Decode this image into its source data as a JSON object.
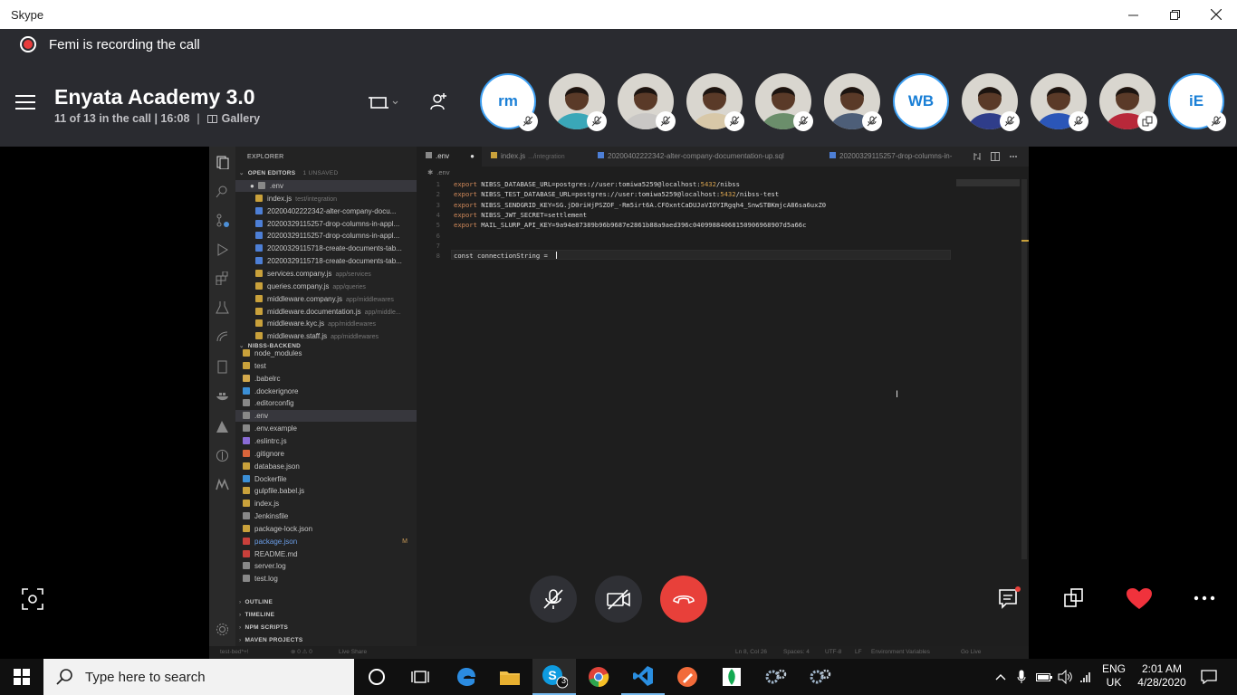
{
  "window": {
    "app_name": "Skype"
  },
  "recording": {
    "text": "Femi is recording the call"
  },
  "call": {
    "title": "Enyata Academy 3.0",
    "count_text": "11 of 13 in the call | 16:08",
    "view_mode": "Gallery"
  },
  "participants": [
    {
      "type": "initials",
      "label": "rm",
      "muted": true
    },
    {
      "type": "photo",
      "muted": true,
      "color": "#3aa7b8"
    },
    {
      "type": "photo",
      "muted": true,
      "color": "#c9c7c5"
    },
    {
      "type": "photo",
      "muted": true,
      "color": "#d8c8a8"
    },
    {
      "type": "photo",
      "muted": true,
      "color": "#6b8e6b"
    },
    {
      "type": "photo",
      "muted": true,
      "color": "#4d5e78"
    },
    {
      "type": "initials",
      "label": "WB",
      "muted": false
    },
    {
      "type": "photo",
      "muted": true,
      "color": "#2f3d8a"
    },
    {
      "type": "photo",
      "muted": true,
      "color": "#2b56b8"
    },
    {
      "type": "photo",
      "muted": false,
      "color": "#b8283a",
      "sharing": true
    },
    {
      "type": "initials",
      "label": "iE",
      "muted": true
    }
  ],
  "vscode": {
    "explorer_title": "EXPLORER",
    "open_editors": {
      "title": "OPEN EDITORS",
      "badge": "1 UNSAVED"
    },
    "open_files": [
      {
        "name": ".env",
        "path": "",
        "icon": "#888888",
        "active": true,
        "dirty": true
      },
      {
        "name": "index.js",
        "path": "test/integration",
        "icon": "#c9a13b"
      },
      {
        "name": "20200402222342-alter-company-docu...",
        "path": "",
        "icon": "#4d7fd6"
      },
      {
        "name": "20200329115257-drop-columns-in-appl...",
        "path": "",
        "icon": "#4d7fd6"
      },
      {
        "name": "20200329115257-drop-columns-in-appl...",
        "path": "",
        "icon": "#4d7fd6"
      },
      {
        "name": "20200329115718-create-documents-tab...",
        "path": "",
        "icon": "#4d7fd6"
      },
      {
        "name": "20200329115718-create-documents-tab...",
        "path": "",
        "icon": "#4d7fd6"
      },
      {
        "name": "services.company.js",
        "path": "app/services",
        "icon": "#c9a13b"
      },
      {
        "name": "queries.company.js",
        "path": "app/queries",
        "icon": "#c9a13b"
      },
      {
        "name": "middleware.company.js",
        "path": "app/middlewares",
        "icon": "#c9a13b"
      },
      {
        "name": "middleware.documentation.js",
        "path": "app/middle...",
        "icon": "#c9a13b"
      },
      {
        "name": "middleware.kyc.js",
        "path": "app/middlewares",
        "icon": "#c9a13b"
      },
      {
        "name": "middleware.staff.js",
        "path": "app/middlewares",
        "icon": "#c9a13b"
      }
    ],
    "project": {
      "title": "NIBSS-BACKEND"
    },
    "project_files": [
      {
        "name": "node_modules",
        "icon": "#c9a13b"
      },
      {
        "name": "test",
        "icon": "#c9a13b"
      },
      {
        "name": ".babelrc",
        "icon": "#d4a94c"
      },
      {
        "name": ".dockerignore",
        "icon": "#3b8fd6"
      },
      {
        "name": ".editorconfig",
        "icon": "#888888"
      },
      {
        "name": ".env",
        "icon": "#888888",
        "active": true
      },
      {
        "name": ".env.example",
        "icon": "#888888"
      },
      {
        "name": ".eslintrc.js",
        "icon": "#8a6bd6"
      },
      {
        "name": ".gitignore",
        "icon": "#d9653b"
      },
      {
        "name": "database.json",
        "icon": "#c9a13b"
      },
      {
        "name": "Dockerfile",
        "icon": "#3b8fd6"
      },
      {
        "name": "gulpfile.babel.js",
        "icon": "#c9a13b"
      },
      {
        "name": "index.js",
        "icon": "#c9a13b"
      },
      {
        "name": "Jenkinsfile",
        "icon": "#888888"
      },
      {
        "name": "package-lock.json",
        "icon": "#c9a13b"
      },
      {
        "name": "package.json",
        "icon": "#c9403b",
        "modified": true,
        "badge": "M"
      },
      {
        "name": "README.md",
        "icon": "#c9403b"
      },
      {
        "name": "server.log",
        "icon": "#888888"
      },
      {
        "name": "test.log",
        "icon": "#888888"
      }
    ],
    "outline_sections": [
      "OUTLINE",
      "TIMELINE",
      "NPM SCRIPTS",
      "MAVEN PROJECTS"
    ],
    "tabs": [
      {
        "label": ".env",
        "path": "",
        "active": true
      },
      {
        "label": "index.js",
        "path": ".../integration"
      },
      {
        "label": "20200402222342-alter-company-documentation-up.sql",
        "path": ""
      },
      {
        "label": "20200329115257-drop-columns-in-",
        "path": ""
      }
    ],
    "breadcrumb": ".env",
    "lines": [
      {
        "n": "1",
        "kw": "export",
        "a": " NIBSS_DATABASE_URL=postgres://user:tomiwa5259@localhost:",
        "port": "5432",
        "b": "/nibss"
      },
      {
        "n": "2",
        "kw": "export",
        "a": " NIBSS_TEST_DATABASE_URL=postgres://user:tomiwa5259@localhost:",
        "port": "5432",
        "b": "/nibss-test"
      },
      {
        "n": "3",
        "kw": "export",
        "a": " NIBSS_SENDGRID_KEY=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",
        "port": "",
        "b": ""
      },
      {
        "n": "4",
        "kw": "export",
        "a": " NIBSS_JWT_SECRET=settlement",
        "port": "",
        "b": ""
      },
      {
        "n": "5",
        "kw": "export",
        "a": " MAIL_SLURP_API_KEY=9a94e87389b96b9687e2861b88a9aed396c04099884068150906968907d5a66c",
        "port": "",
        "b": ""
      },
      {
        "n": "6",
        "kw": "",
        "a": "",
        "port": "",
        "b": ""
      },
      {
        "n": "7",
        "kw": "",
        "a": "",
        "port": "",
        "b": ""
      },
      {
        "n": "8",
        "kw": "",
        "a": "const connectionString = ",
        "port": "",
        "b": ""
      }
    ],
    "status": {
      "branch": "test-bed*+!",
      "problems": "⊗ 0 ⚠ 0",
      "live_share": "Live Share",
      "position": "Ln 8, Col 26",
      "spaces": "Spaces: 4",
      "encoding": "UTF-8",
      "eol": "LF",
      "env": "Environment Variables",
      "golive": "Go Live"
    }
  },
  "taskbar": {
    "search_placeholder": "Type here to search",
    "skype_badge": "3",
    "lang_top": "ENG",
    "lang_bottom": "UK",
    "time": "2:01 AM",
    "date": "4/28/2020"
  },
  "colors": {
    "header_bg": "#2a2b30",
    "end_call": "#e8403a",
    "accent_blue": "#3ea0f3",
    "heart": "#f0323c"
  }
}
